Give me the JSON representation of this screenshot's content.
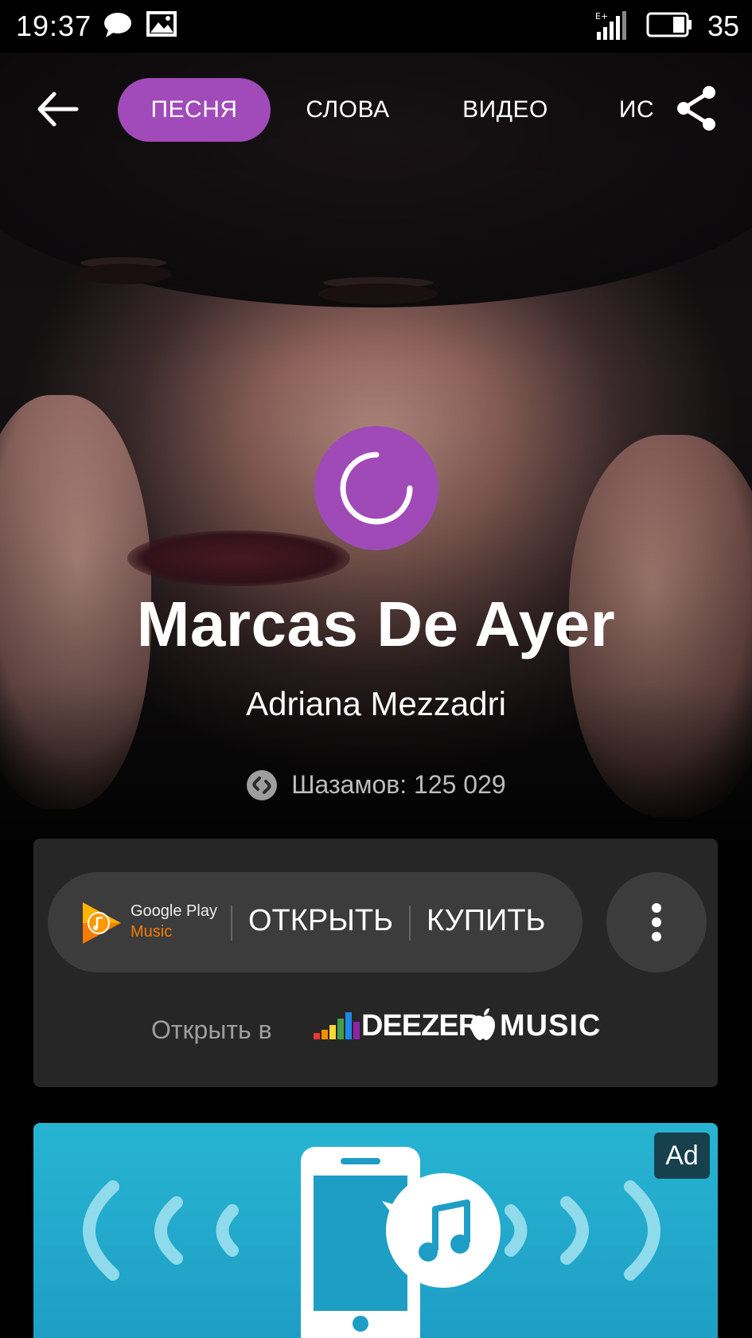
{
  "status_bar": {
    "time": "19:37",
    "battery_level": "35",
    "icons": [
      "chat-bubble-icon",
      "image-icon",
      "signal-icon",
      "battery-icon"
    ]
  },
  "nav": {
    "tabs": [
      {
        "label": "ПЕСНЯ",
        "active": true
      },
      {
        "label": "СЛОВА",
        "active": false
      },
      {
        "label": "ВИДЕО",
        "active": false
      },
      {
        "label": "ИС",
        "active": false
      }
    ]
  },
  "song": {
    "title": "Marcas De Ayer",
    "artist": "Adriana Mezzadri",
    "shazam_count": "Шазамов: 125 029"
  },
  "provider": {
    "brand_line1": "Google Play",
    "brand_line2": "Music",
    "open_label": "ОТКРЫТЬ",
    "buy_label": "КУПИТЬ",
    "open_in_label": "Открыть в",
    "deezer_label": "DEEZER",
    "apple_music_label": "MUSIC"
  },
  "ad": {
    "badge": "Ad"
  },
  "colors": {
    "accent_purple": "#a14ab9",
    "panel_bg": "#262626",
    "pill_bg": "#3c3c3c",
    "ad_bg": "#27b4d2"
  }
}
